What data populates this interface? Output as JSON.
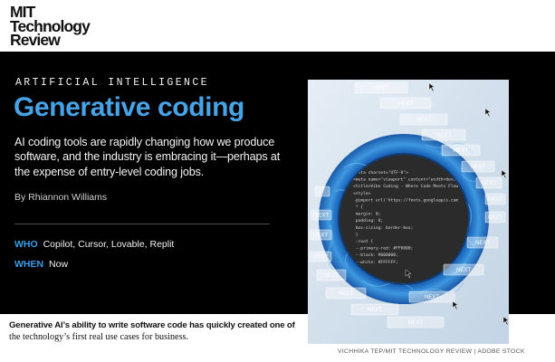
{
  "brand": {
    "logo_lines": [
      "MIT",
      "Technology",
      "Review"
    ]
  },
  "article": {
    "kicker": "ARTIFICIAL INTELLIGENCE",
    "title": "Generative coding",
    "dek": "AI coding tools are rapidly changing how we produce software, and the industry is embracing it—perhaps at the expense of entry-level coding jobs.",
    "byline": "By Rhiannon Williams",
    "who": {
      "label": "WHO",
      "value": "Copilot, Cursor, Lovable, Replit"
    },
    "when": {
      "label": "WHEN",
      "value": "Now"
    }
  },
  "caption": {
    "line1": "Generative AI’s ability to write software code has quickly created one of",
    "line2": "the technology’s first real use cases for business."
  },
  "image": {
    "credit": "VICHHIKA TEP/MIT TECHNOLOGY REVIEW | ADOBE STOCK",
    "button_label": "NEXT",
    "code_lines": [
      "<meta charset=\"UTF-8\">",
      "<meta name=\"viewport\" content=\"width=devi",
      "<title>Vibe Coding - Where Code Meets Flow",
      "<style>",
      "  @import url('https://fonts.googleapis.com",
      "  * {",
      "    margin: 0;",
      "    padding: 0;",
      "    box-sizing: border-box;",
      "  }",
      "  :root {",
      "    --primary-red: #FF0000;",
      "    --black: #000000;",
      "    --white: #FFFFFF;"
    ]
  },
  "colors": {
    "accent_blue": "#46a3e6",
    "hero_background": "#000000",
    "page_background": "#ffffff"
  }
}
